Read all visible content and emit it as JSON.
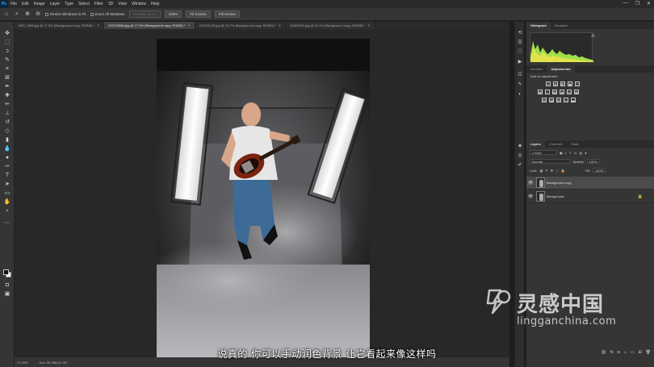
{
  "app": {
    "logo": "Ps",
    "menus": [
      "File",
      "Edit",
      "Image",
      "Layer",
      "Type",
      "Select",
      "Filter",
      "3D",
      "View",
      "Window",
      "Help"
    ],
    "window_controls": [
      "—",
      "❐",
      "✕"
    ]
  },
  "options_bar": {
    "resize_windows_label": "Resize Windows to Fit",
    "zoom_all_label": "Zoom All Windows",
    "scrubby_label": "Scrubby Zoom",
    "zoom_value": "100%",
    "fit_screen_label": "Fit Screen",
    "fill_screen_label": "Fill Screen"
  },
  "tabs": [
    {
      "label": "IMG_1586.jpg @ 17.5% (Background copy, RGB/8) *",
      "active": false
    },
    {
      "label": "DSC04884.jpg @ 17.9% (Background copy, RGB/8) *",
      "active": true
    },
    {
      "label": "DSC04129.jpg @ 15.7% (Background copy, RGB/8) *",
      "active": false
    },
    {
      "label": "16084315.jpg @ 20.1% (Background copy, RGB/8) *",
      "active": false
    }
  ],
  "status_bar": {
    "zoom": "17.93%",
    "doc": "Doc: 55.9M/111.7M"
  },
  "panels": {
    "top_tabs": [
      "Histogram",
      "Navigator"
    ],
    "adj_tabs": [
      "Libraries",
      "Adjustments"
    ],
    "adj_title": "Add an adjustment",
    "adj_icons": [
      [
        "☀",
        "▥",
        "◩",
        "▣",
        "▽"
      ],
      [
        "▦",
        "◐",
        "▩",
        "◉",
        "▤",
        "▦"
      ],
      [
        "▧",
        "◪",
        "▨",
        "▭",
        "▬"
      ]
    ],
    "layers_tabs": [
      "Layers",
      "Channels",
      "Paths"
    ],
    "kind_label": "Kind",
    "blend_mode": "Normal",
    "opacity_label": "Opacity:",
    "opacity_value": "100%",
    "lock_label": "Lock:",
    "fill_label": "Fill:",
    "fill_value": "100%",
    "layers": [
      {
        "name": "Background copy",
        "active": true,
        "locked": false
      },
      {
        "name": "Background",
        "active": false,
        "locked": true
      }
    ],
    "footer_icons": [
      "⛓",
      "fx",
      "◘",
      "◑",
      "▭",
      "⊞",
      "🗑"
    ]
  },
  "overlay": {
    "subtitle": "说真的 你可以手动润色背景 让它看起来像这样吗",
    "watermark_cn": "灵感中国",
    "watermark_en": "lingganchina.com"
  },
  "colors": {
    "accent": "#31a8ff",
    "histogram_green": "#9fe04a",
    "histogram_yellow": "#f2e44a"
  }
}
